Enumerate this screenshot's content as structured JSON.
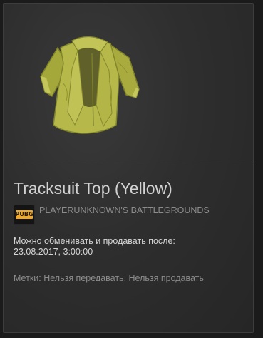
{
  "item": {
    "name": "Tracksuit Top (Yellow)",
    "image_icon": "yellow-jacket-icon"
  },
  "game": {
    "logo_text": "PUBG",
    "name": "PLAYERUNKNOWN'S BATTLEGROUNDS"
  },
  "trade": {
    "line1": "Можно обменивать и продавать после:",
    "line2": "23.08.2017, 3:00:00"
  },
  "tags": {
    "text": "Метки: Нельзя передавать, Нельзя продавать"
  },
  "colors": {
    "panel_bg": "#2e2e2e",
    "title": "#d2d2d2",
    "muted": "#8c8c8c",
    "jacket": "#b5b74a",
    "pubg_badge": "#f3a923"
  }
}
